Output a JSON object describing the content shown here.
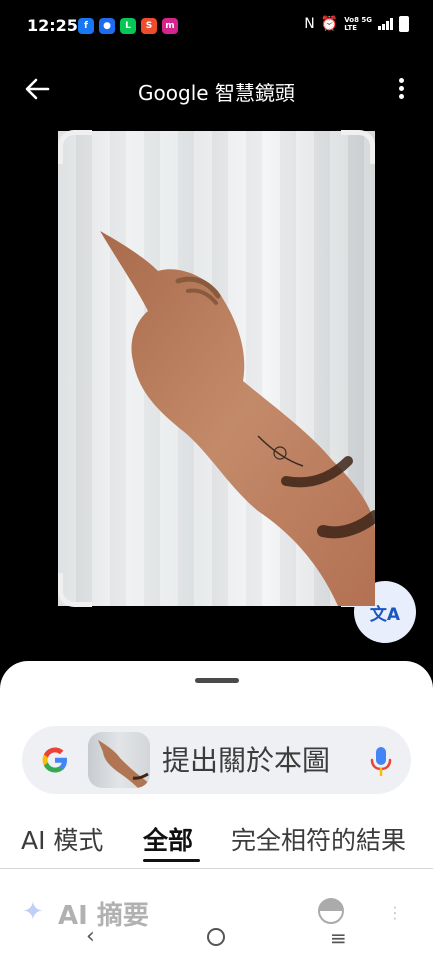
{
  "status_bar": {
    "time": "12:25",
    "notifications": [
      "facebook-icon",
      "messenger-icon",
      "line-icon",
      "shopee-icon",
      "momo-icon"
    ],
    "net_top": "Vo8 5G",
    "net_bottom": "LTE"
  },
  "header": {
    "title": "Google 智慧鏡頭"
  },
  "translate_button": {
    "label": "文A"
  },
  "search": {
    "placeholder": "提出關於本圖",
    "mic_icon": "mic-icon"
  },
  "tabs": [
    {
      "label": "AI 模式",
      "active": false
    },
    {
      "label": "全部",
      "active": true
    },
    {
      "label": "完全相符的結果",
      "active": false
    }
  ],
  "ai_overview": {
    "label": "AI 摘要"
  },
  "colors": {
    "accent_blue": "#1a56c4",
    "google_blue": "#4285F4",
    "google_red": "#EA4335",
    "google_yellow": "#FBBC05",
    "google_green": "#34A853"
  }
}
